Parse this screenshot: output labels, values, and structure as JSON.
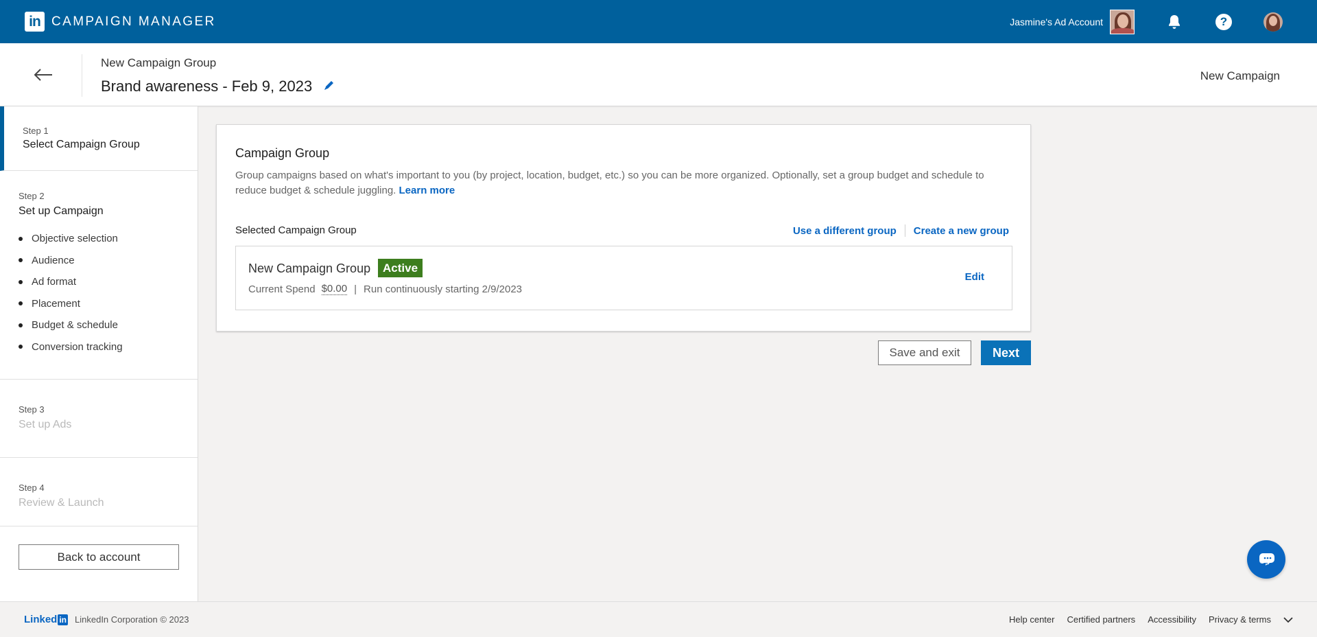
{
  "topbar": {
    "logo_text": "in",
    "brand_title": "CAMPAIGN MANAGER",
    "account_name": "Jasmine's Ad Account",
    "help_label": "?"
  },
  "header": {
    "group_label": "New Campaign Group",
    "campaign_name": "Brand awareness - Feb 9, 2023",
    "new_campaign": "New Campaign"
  },
  "sidebar": {
    "step1": {
      "num": "Step 1",
      "title": "Select Campaign Group"
    },
    "step2": {
      "num": "Step 2",
      "title": "Set up Campaign",
      "items": [
        "Objective selection",
        "Audience",
        "Ad format",
        "Placement",
        "Budget & schedule",
        "Conversion tracking"
      ]
    },
    "step3": {
      "num": "Step 3",
      "title": "Set up Ads"
    },
    "step4": {
      "num": "Step 4",
      "title": "Review & Launch"
    },
    "back_button": "Back to account"
  },
  "card": {
    "title": "Campaign Group",
    "description": "Group campaigns based on what's important to you (by project, location, budget, etc.) so you can be more organized. Optionally, set a group budget and schedule to reduce budget & schedule juggling.",
    "learn_more": "Learn more",
    "selected_label": "Selected Campaign Group",
    "use_different": "Use a different group",
    "create_new": "Create a new group",
    "group": {
      "name": "New Campaign Group",
      "status": "Active",
      "spend_label": "Current Spend",
      "spend_value": "$0.00",
      "separator": "|",
      "schedule": "Run continuously starting 2/9/2023",
      "edit": "Edit"
    }
  },
  "actions": {
    "save_exit": "Save and exit",
    "next": "Next"
  },
  "footer": {
    "logo_text": "Linked",
    "logo_in": "in",
    "copyright": "LinkedIn Corporation © 2023",
    "links": [
      "Help center",
      "Certified partners",
      "Accessibility",
      "Privacy & terms"
    ]
  },
  "colors": {
    "brand_blue": "#00609c",
    "link_blue": "#0a66c2",
    "active_green": "#3d7e1e"
  }
}
